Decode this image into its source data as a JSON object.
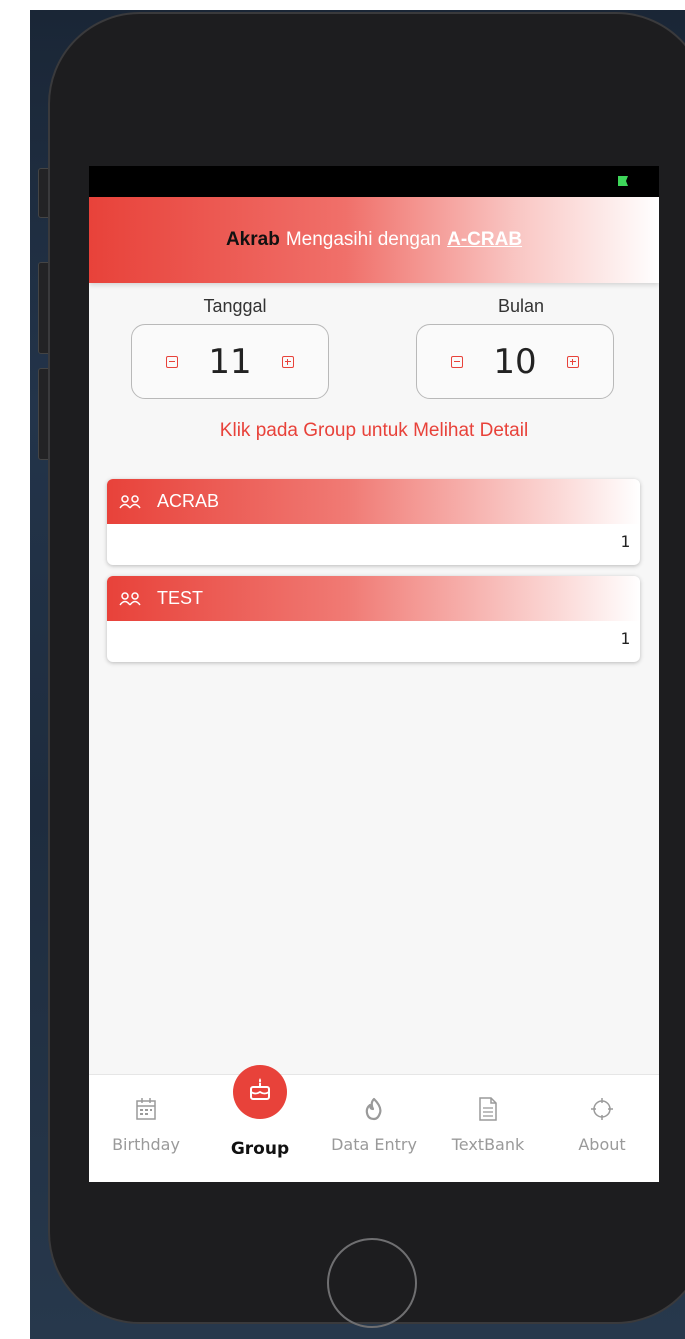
{
  "header": {
    "brand": "Akrab",
    "tagline": "Mengasihi dengan",
    "acrab": "A-CRAB"
  },
  "pickers": [
    {
      "label": "Tanggal",
      "value": "11"
    },
    {
      "label": "Bulan",
      "value": "10"
    }
  ],
  "hint": "Klik pada Group untuk Melihat Detail",
  "groups": [
    {
      "name": "ACRAB",
      "count": "1"
    },
    {
      "name": "TEST",
      "count": "1"
    }
  ],
  "tabs": [
    {
      "label": "Birthday",
      "icon": "calendar-icon",
      "active": false
    },
    {
      "label": "Group",
      "icon": "cake-icon",
      "active": true
    },
    {
      "label": "Data Entry",
      "icon": "flame-icon",
      "active": false
    },
    {
      "label": "TextBank",
      "icon": "document-icon",
      "active": false
    },
    {
      "label": "About",
      "icon": "crosshair-icon",
      "active": false
    }
  ],
  "colors": {
    "accent": "#e8423a",
    "status_battery": "#3ed65a"
  }
}
